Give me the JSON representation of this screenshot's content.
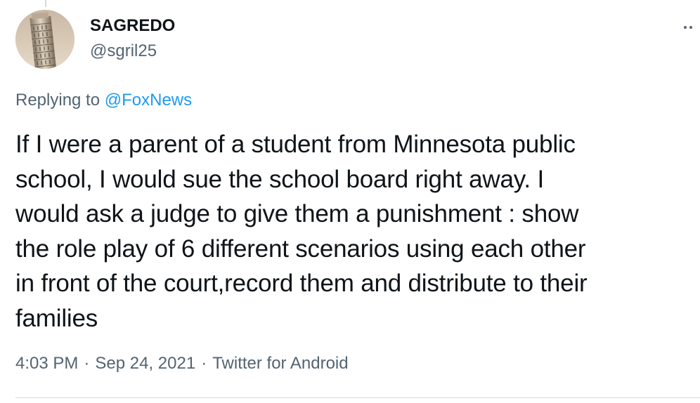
{
  "tweet": {
    "author": {
      "display_name": "SAGREDO",
      "handle": "@sgril25",
      "avatar_icon": "leaning-tower-of-pisa-photo"
    },
    "reply_prefix": "Replying to",
    "reply_to": "@FoxNews",
    "text_lines": [
      "If I were a parent of a student from Minnesota public",
      "school, I would sue the school board right away. I",
      "would ask a judge to give them a punishment : show",
      "the role play of 6 different scenarios using each other",
      "in front of the court,record them and distribute to their",
      "families"
    ],
    "time": "4:03 PM",
    "date": "Sep 24, 2021",
    "separator": "·",
    "source": "Twitter for Android"
  },
  "colors": {
    "text": "#0f1419",
    "secondary": "#536471",
    "link": "#1d9bf0",
    "border": "#cfd9de"
  }
}
